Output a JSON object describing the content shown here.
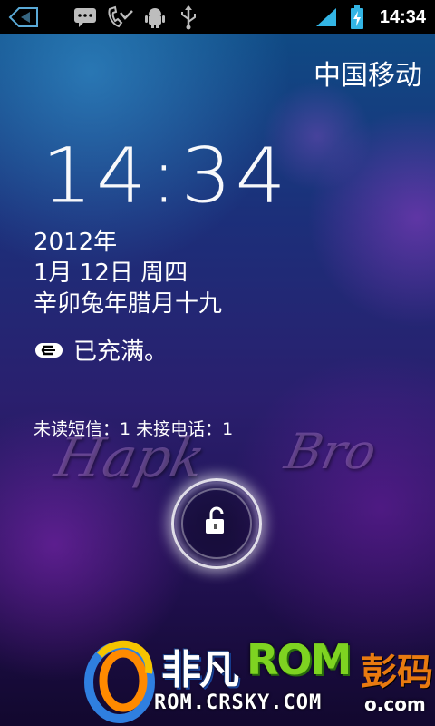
{
  "status_bar": {
    "time": "14:34",
    "icons": [
      "back-arrow-icon",
      "sms-icon",
      "missed-call-icon",
      "android-debug-icon",
      "usb-icon",
      "signal-icon",
      "battery-charging-icon"
    ]
  },
  "carrier": "中国移动",
  "clock": "14:34",
  "date": {
    "year": "2012年",
    "day": "1月 12日 周四",
    "lunar": "辛卯兔年腊月十九"
  },
  "charging": {
    "icon": "charging-icon",
    "text": "已充满。"
  },
  "notifications": {
    "missed_summary": "未读短信：1 未接电话：1"
  },
  "watermark": {
    "left": "Hapk",
    "right": "Bro"
  },
  "unlock": {
    "icon": "unlock-padlock-icon"
  },
  "logo": {
    "brand": "非凡",
    "rom": "ROM",
    "suffix": "彭码",
    "url": "ROM.CRSKY.COM",
    "url_suffix": "o.com"
  },
  "colors": {
    "statusbar_bg": "#000000",
    "battery_accent": "#33b5e5",
    "signal_accent": "#33b5e5",
    "logo_green": "#7ed321",
    "logo_orange": "#e87a10"
  }
}
